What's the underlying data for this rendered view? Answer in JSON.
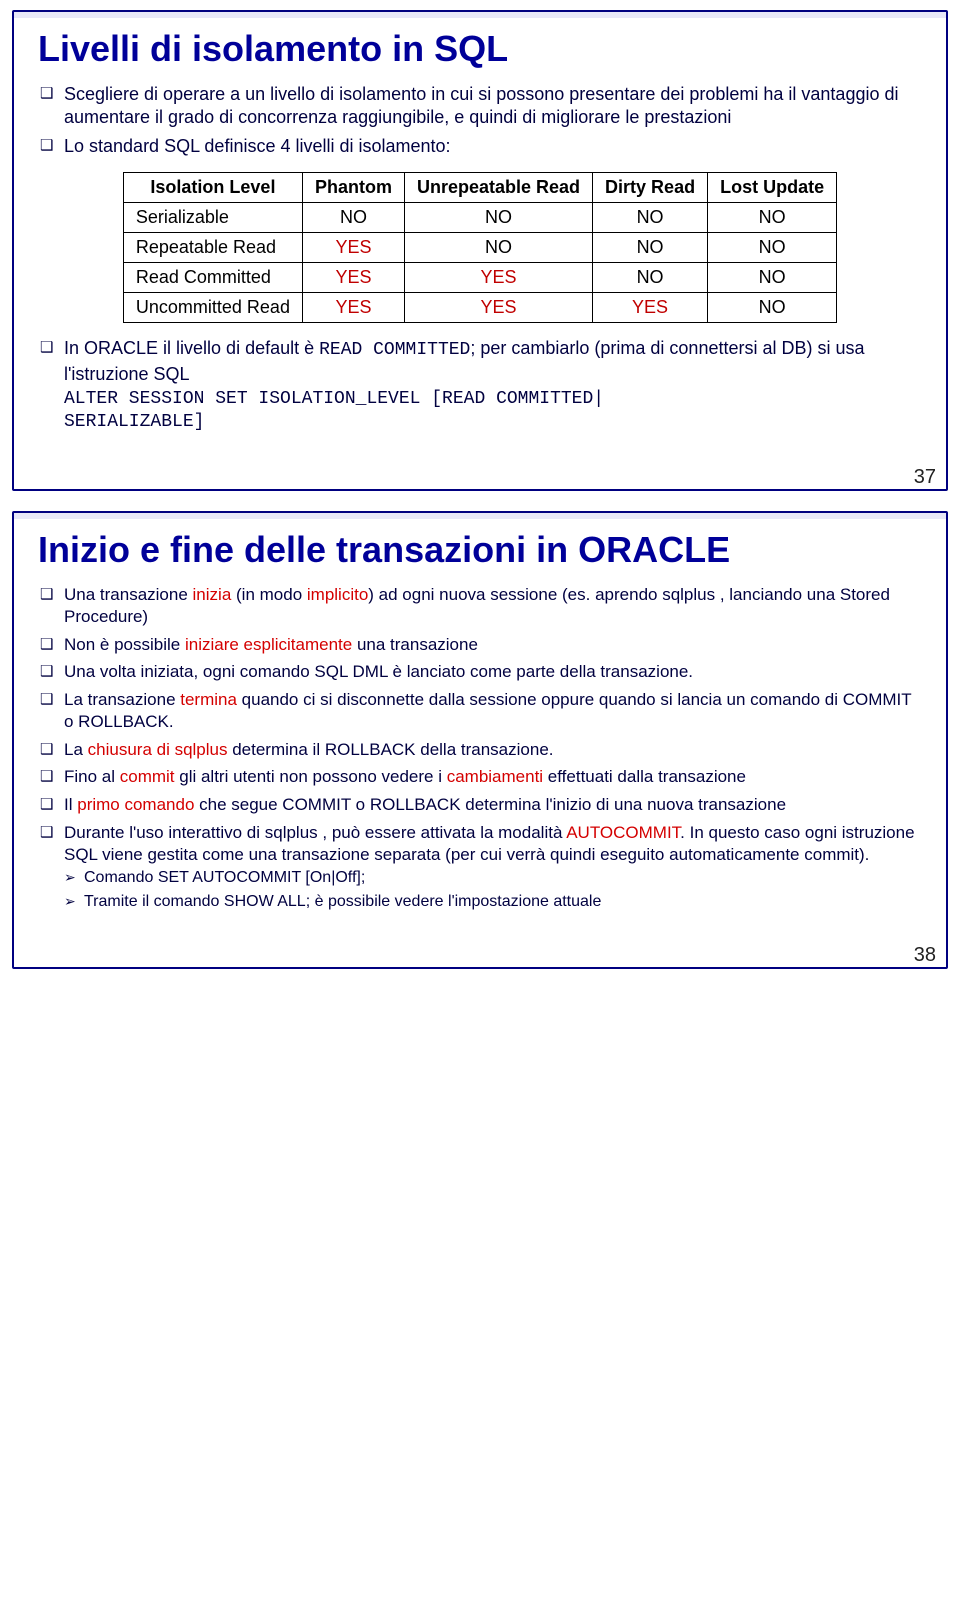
{
  "slide37": {
    "title": "Livelli di isolamento in SQL",
    "b1": "Scegliere di operare a un livello di isolamento in cui si possono presentare dei problemi ha il vantaggio di aumentare il grado di concorrenza raggiungibile, e quindi di migliorare le prestazioni",
    "b2": "Lo standard SQL definisce 4 livelli di isolamento:",
    "b3pre": "In ORACLE il livello di default è ",
    "b3code1": "READ COMMITTED",
    "b3mid": "; per cambiarlo (prima di connettersi al DB) si usa l'istruzione SQL",
    "code_line1": "ALTER SESSION SET ISOLATION_LEVEL [READ COMMITTED|",
    "code_line2": "SERIALIZABLE]",
    "page": "37",
    "table": {
      "headers": [
        "Isolation Level",
        "Phantom",
        "Unrepeatable Read",
        "Dirty Read",
        "Lost Update"
      ],
      "rows": [
        {
          "label": "Serializable",
          "c": [
            "NO",
            "NO",
            "NO",
            "NO"
          ]
        },
        {
          "label": "Repeatable Read",
          "c": [
            "YES",
            "NO",
            "NO",
            "NO"
          ]
        },
        {
          "label": "Read Committed",
          "c": [
            "YES",
            "YES",
            "NO",
            "NO"
          ]
        },
        {
          "label": "Uncommitted Read",
          "c": [
            "YES",
            "YES",
            "YES",
            "NO"
          ]
        }
      ]
    }
  },
  "slide38": {
    "title": "Inizio e fine delle transazioni in ORACLE",
    "b1_pre": "Una transazione ",
    "b1_red": "inizia",
    "b1_mid": " (in modo ",
    "b1_red2": "implicito",
    "b1_post": ") ad ogni nuova sessione (es. aprendo sqlplus , lanciando una Stored Procedure)",
    "b2_pre": "Non è possibile ",
    "b2_red": "iniziare esplicitamente",
    "b2_post": " una transazione",
    "b3": "Una volta iniziata, ogni comando SQL DML è lanciato come parte della transazione.",
    "b4_pre": "La transazione ",
    "b4_red": "termina",
    "b4_post": " quando ci si disconnette dalla sessione oppure quando si lancia un comando di COMMIT o ROLLBACK.",
    "b5_pre": "La ",
    "b5_red": "chiusura di sqlplus",
    "b5_post": " determina il ROLLBACK della transazione.",
    "b6_pre": "Fino al ",
    "b6_red": "commit ",
    "b6_mid": "gli altri utenti non possono vedere i ",
    "b6_red2": "cambiamenti",
    "b6_post": " effettuati dalla transazione",
    "b7_pre": "Il ",
    "b7_red": "primo comando",
    "b7_post": " che segue COMMIT o ROLLBACK determina l'inizio di una nuova transazione",
    "b8_pre": "Durante l'uso interattivo di sqlplus , può essere attivata la modalità ",
    "b8_red": "AUTOCOMMIT",
    "b8_post": ". In questo caso ogni istruzione SQL viene gestita come una transazione separata (per cui verrà quindi eseguito automaticamente commit).",
    "sub1": "Comando SET AUTOCOMMIT [On|Off];",
    "sub2": "Tramite il comando SHOW ALL; è possibile vedere l'impostazione attuale",
    "page": "38"
  },
  "chart_data": {
    "type": "table",
    "title": "SQL isolation levels",
    "columns": [
      "Isolation Level",
      "Phantom",
      "Unrepeatable Read",
      "Dirty Read",
      "Lost Update"
    ],
    "rows": [
      [
        "Serializable",
        "NO",
        "NO",
        "NO",
        "NO"
      ],
      [
        "Repeatable Read",
        "YES",
        "NO",
        "NO",
        "NO"
      ],
      [
        "Read Committed",
        "YES",
        "YES",
        "NO",
        "NO"
      ],
      [
        "Uncommitted Read",
        "YES",
        "YES",
        "YES",
        "NO"
      ]
    ]
  }
}
